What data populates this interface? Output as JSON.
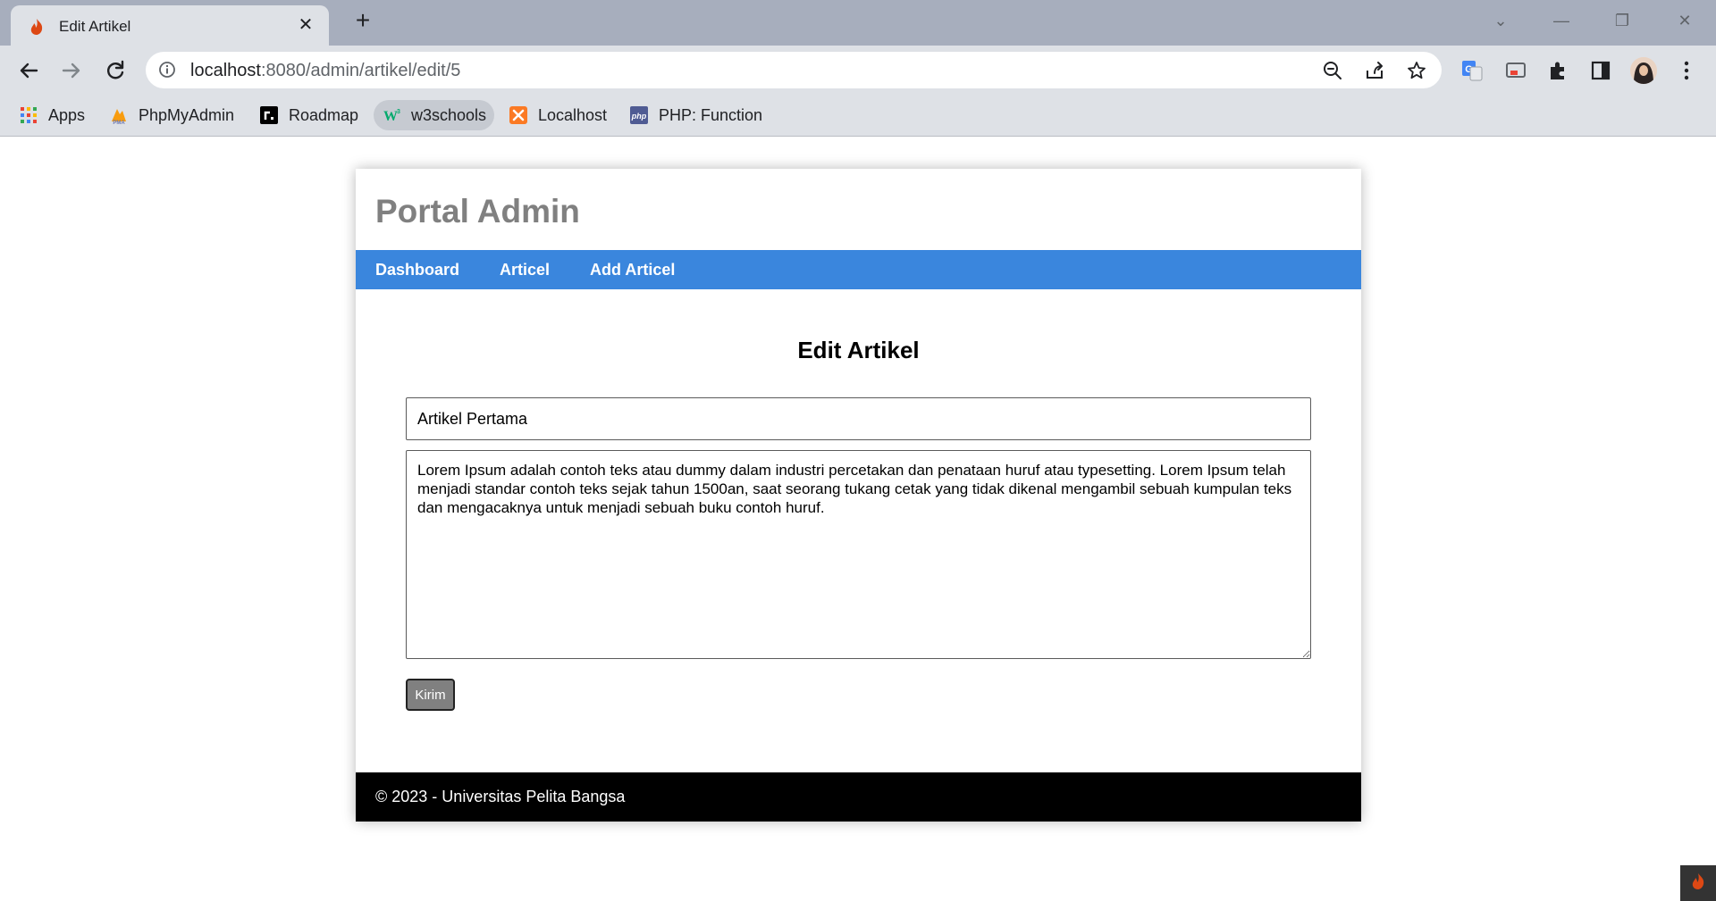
{
  "browser": {
    "tab_title": "Edit Artikel",
    "url_host": "localhost",
    "url_path": ":8080/admin/artikel/edit/5",
    "bookmarks": [
      {
        "label": "Apps",
        "icon": "apps-grid-icon"
      },
      {
        "label": "PhpMyAdmin",
        "icon": "phpmyadmin-icon"
      },
      {
        "label": "Roadmap",
        "icon": "roadmap-icon"
      },
      {
        "label": "w3schools",
        "icon": "w3schools-icon"
      },
      {
        "label": "Localhost",
        "icon": "xampp-icon"
      },
      {
        "label": "PHP: Function",
        "icon": "php-icon"
      }
    ]
  },
  "page": {
    "site_title": "Portal Admin",
    "nav": [
      "Dashboard",
      "Articel",
      "Add Articel"
    ],
    "heading": "Edit Artikel",
    "form": {
      "title_value": "Artikel Pertama",
      "content_value": "Lorem Ipsum adalah contoh teks atau dummy dalam industri percetakan dan penataan huruf atau typesetting. Lorem Ipsum telah menjadi standar contoh teks sejak tahun 1500an, saat seorang tukang cetak yang tidak dikenal mengambil sebuah kumpulan teks dan mengacaknya untuk menjadi sebuah buku contoh huruf.",
      "submit_label": "Kirim"
    },
    "footer": "© 2023 - Universitas Pelita Bangsa"
  },
  "colors": {
    "navbar": "#3a86dd",
    "title": "#808080",
    "footer": "#000000",
    "button": "#808080"
  }
}
